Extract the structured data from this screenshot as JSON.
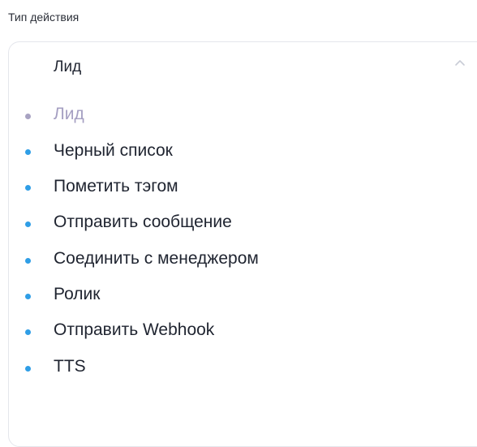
{
  "field": {
    "label": "Тип действия"
  },
  "select": {
    "selected_value": "Лид",
    "chevron_icon": "chevron-up-icon"
  },
  "options": [
    {
      "label": "Лид",
      "state": "selected"
    },
    {
      "label": "Черный список",
      "state": "normal"
    },
    {
      "label": "Пометить тэгом",
      "state": "normal"
    },
    {
      "label": "Отправить сообщение",
      "state": "normal"
    },
    {
      "label": "Соединить с менеджером",
      "state": "normal"
    },
    {
      "label": "Ролик",
      "state": "normal"
    },
    {
      "label": "Отправить Webhook",
      "state": "normal"
    },
    {
      "label": "TTS",
      "state": "normal"
    }
  ],
  "colors": {
    "bullet": "#2f9ee6",
    "selected_text": "#a59fc2",
    "text": "#1f2430",
    "border": "#e4e6ec"
  }
}
